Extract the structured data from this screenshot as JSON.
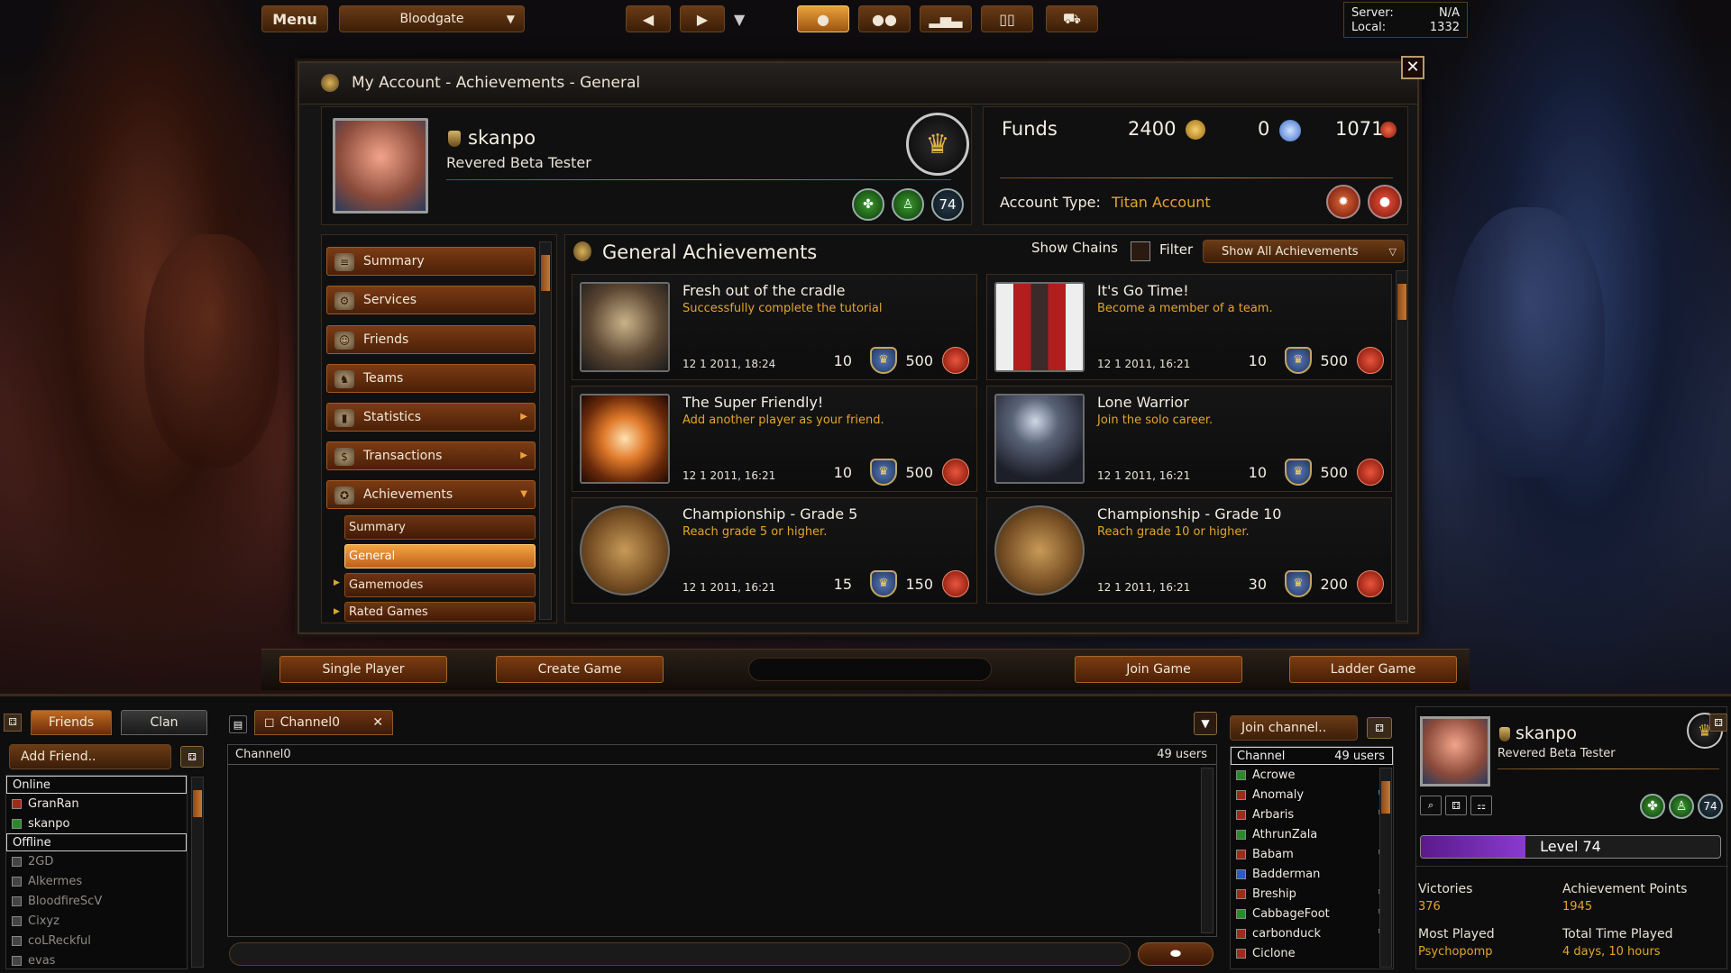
{
  "topbar": {
    "menu": "Menu",
    "realm": "Bloodgate",
    "server_label": "Server:",
    "server_value": "N/A",
    "local_label": "Local:",
    "local_value": "1332"
  },
  "window": {
    "title": "My Account - Achievements - General"
  },
  "profile": {
    "name": "skanpo",
    "title": "Revered Beta Tester",
    "level_badge": "74"
  },
  "funds": {
    "label": "Funds",
    "gold": "2400",
    "gems": "0",
    "tokens": "1071",
    "account_type_label": "Account Type:",
    "account_type_value": "Titan Account"
  },
  "nav": {
    "items": [
      "Summary",
      "Services",
      "Friends",
      "Teams",
      "Statistics",
      "Transactions",
      "Achievements"
    ],
    "sub_items": [
      "Summary",
      "General",
      "Gamemodes",
      "Rated Games"
    ]
  },
  "achievements": {
    "header": "General Achievements",
    "show_chains": "Show Chains",
    "filter": "Filter",
    "filter_value": "Show All Achievements",
    "cards": [
      {
        "title": "Fresh out of the cradle",
        "desc": "Successfully complete the tutorial",
        "date": "12 1 2011, 18:24",
        "points": "10",
        "reward": "500"
      },
      {
        "title": "It's Go Time!",
        "desc": "Become a member of a team.",
        "date": "12 1 2011, 16:21",
        "points": "10",
        "reward": "500"
      },
      {
        "title": "The Super Friendly!",
        "desc": "Add another player as your friend.",
        "date": "12 1 2011, 16:21",
        "points": "10",
        "reward": "500"
      },
      {
        "title": "Lone Warrior",
        "desc": "Join the solo career.",
        "date": "12 1 2011, 16:21",
        "points": "10",
        "reward": "500"
      },
      {
        "title": "Championship - Grade 5",
        "desc": "Reach grade 5 or higher.",
        "date": "12 1 2011, 16:21",
        "points": "15",
        "reward": "150"
      },
      {
        "title": "Championship - Grade 10",
        "desc": "Reach grade 10 or higher.",
        "date": "12 1 2011, 16:21",
        "points": "30",
        "reward": "200"
      }
    ]
  },
  "game_buttons": {
    "single": "Single Player",
    "create": "Create Game",
    "join": "Join Game",
    "ladder": "Ladder Game"
  },
  "social": {
    "tab_friends": "Friends",
    "tab_clan": "Clan",
    "add_friend": "Add Friend..",
    "online": "Online",
    "offline": "Offline",
    "online_list": [
      "GranRan",
      "skanpo"
    ],
    "offline_list": [
      "2GD",
      "Alkermes",
      "BloodfireScV",
      "Cixyz",
      "coLReckful",
      "evas"
    ]
  },
  "chat": {
    "tab": "Channel0",
    "channel": "Channel0",
    "users": "49 users"
  },
  "channels": {
    "join": "Join channel..",
    "header": "Channel",
    "users": "49 users",
    "list": [
      "Acrowe",
      "Anomaly",
      "Arbaris",
      "AthrunZala",
      "Babam",
      "Badderman",
      "Breship",
      "CabbageFoot",
      "carbonduck",
      "Ciclone"
    ]
  },
  "player_card": {
    "name": "skanpo",
    "title": "Revered Beta Tester",
    "level": "Level 74",
    "level_progress": 0.35,
    "victories_label": "Victories",
    "victories": "376",
    "ap_label": "Achievement Points",
    "ap": "1945",
    "most_played_label": "Most Played",
    "most_played": "Psychopomp",
    "time_label": "Total Time Played",
    "time": "4 days, 10 hours"
  }
}
